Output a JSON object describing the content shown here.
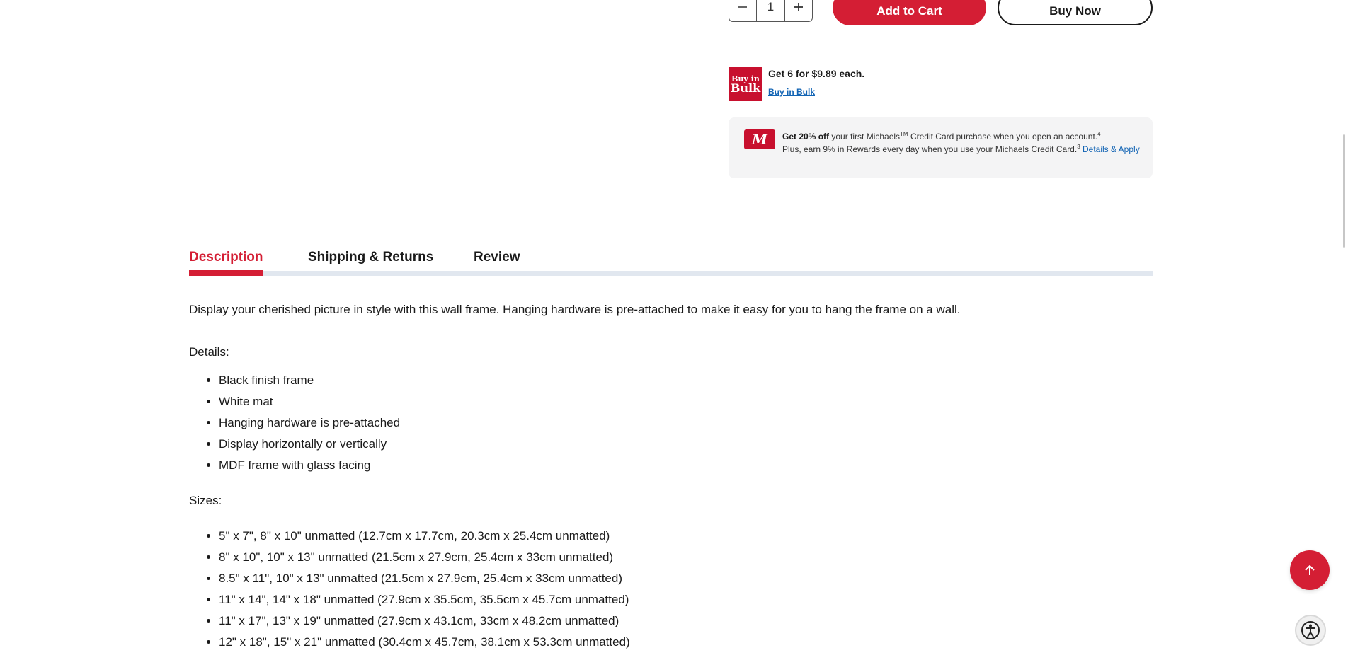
{
  "purchase": {
    "quantity": "1",
    "add_to_cart": "Add to Cart",
    "buy_now": "Buy Now"
  },
  "bulk": {
    "logo_line1": "Buy in",
    "logo_line2": "Bulk",
    "title": "Get 6 for $9.89 each.",
    "link": "Buy in Bulk"
  },
  "credit_promo": {
    "card_mark": "M",
    "bold": "Get 20% off",
    "text1": " your first Michaels",
    "tm": "TM",
    "text2": " Credit Card purchase when you open an account.",
    "sup1": "4",
    "text3": "Plus, earn 9% in Rewards every day when you use your Michaels Credit Card.",
    "sup2": "3",
    "link": " Details & Apply"
  },
  "tabs": [
    {
      "label": "Description"
    },
    {
      "label": "Shipping & Returns"
    },
    {
      "label": "Review"
    }
  ],
  "description": {
    "intro": "Display your cherished picture in style with this wall frame. Hanging hardware is pre-attached to make it easy for you to hang the frame on a wall.",
    "details_label": "Details:",
    "details": [
      "Black finish frame",
      "White mat",
      "Hanging hardware is pre-attached",
      "Display horizontally or vertically",
      "MDF frame with glass facing"
    ],
    "sizes_label": "Sizes:",
    "sizes": [
      "5\" x 7\", 8\" x 10\" unmatted (12.7cm x 17.7cm, 20.3cm x 25.4cm unmatted)",
      "8\" x 10\", 10\" x 13\" unmatted (21.5cm x 27.9cm, 25.4cm x 33cm unmatted)",
      "8.5\" x 11\", 10\" x 13\" unmatted (21.5cm x 27.9cm, 25.4cm x 33cm unmatted)",
      "11\" x 14\", 14\" x 18\" unmatted (27.9cm x 35.5cm, 35.5cm x 45.7cm unmatted)",
      "11\" x 17\", 13\" x 19\" unmatted (27.9cm x 43.1cm, 33cm x 48.2cm unmatted)",
      "12\" x 18\", 15\" x 21\" unmatted (30.4cm x 45.7cm, 38.1cm x 53.3cm unmatted)"
    ]
  },
  "colors": {
    "brand_red": "#d41e34",
    "link_blue": "#1264b4",
    "tab_track": "#e1e7ef"
  },
  "icons": {
    "minus": "minus-icon",
    "plus": "plus-icon",
    "to_top": "arrow-up-icon",
    "accessibility": "accessibility-icon"
  }
}
